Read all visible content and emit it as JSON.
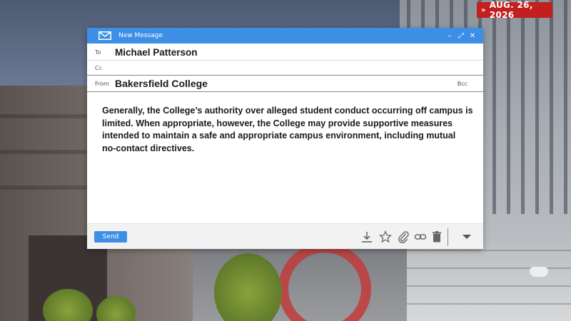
{
  "date_tag": {
    "chevrons": "»",
    "text": "AUG. 26, 2026"
  },
  "window": {
    "title": "New Message",
    "controls": {
      "minimize": "–",
      "expand": "⤢",
      "close": "✕"
    }
  },
  "fields": {
    "to_label": "To",
    "to_value": "Michael Patterson",
    "cc_label": "Cc",
    "from_label": "From",
    "from_value": "Bakersfield College",
    "bcc_label": "Bcc"
  },
  "body": {
    "lines": [
      "Generally, the College’s authority over alleged student conduct occurring off campus is",
      "limited. When appropriate, however, the College may provide supportive measures",
      "intended to maintain a safe and appropriate campus environment, including mutual",
      "no-contact directives."
    ]
  },
  "footer": {
    "send_label": "Send",
    "tools": [
      "download-icon",
      "star-icon",
      "paperclip-icon",
      "link-icon",
      "trash-icon",
      "chevron-down-icon"
    ]
  },
  "colors": {
    "accent_blue": "#3d8fe6",
    "date_tag_red": "#c41f1f",
    "text_dark": "#1a1a1a"
  }
}
